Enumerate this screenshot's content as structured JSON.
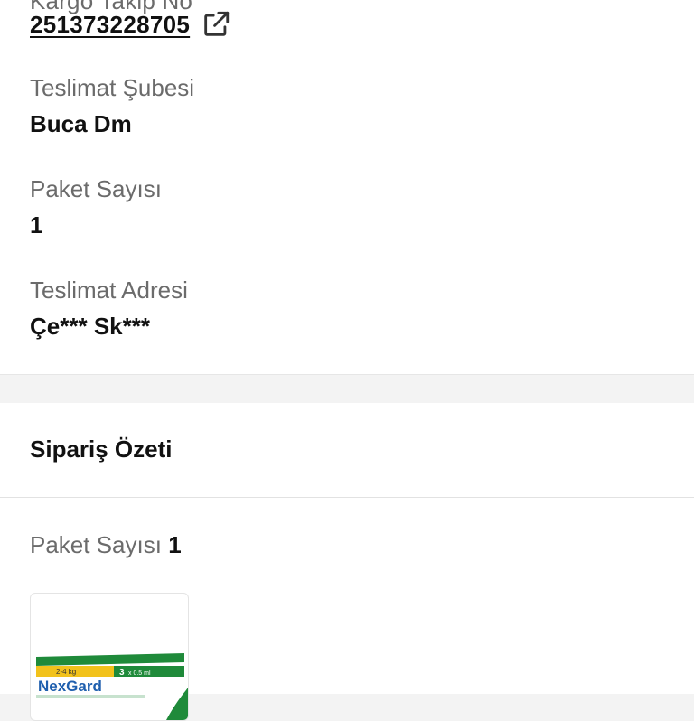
{
  "shipment": {
    "tracking_label_cut": "Kargo Takip No",
    "tracking_number": "251373228705",
    "branch_label": "Teslimat Şubesi",
    "branch_value": "Buca Dm",
    "package_count_label": "Paket Sayısı",
    "package_count_value": "1",
    "address_label": "Teslimat Adresi",
    "address_value": "Çe*** Sk***"
  },
  "summary": {
    "title": "Sipariş Özeti",
    "package_count_label": "Paket Sayısı",
    "package_count_value": "1",
    "product": {
      "brand": "NexGard",
      "pack_weight": "2-4 kg",
      "pack_qty": "3",
      "pack_unit": "x 0.5 ml"
    }
  },
  "colors": {
    "label": "#6b6b6b",
    "value": "#111111",
    "page_bg": "#f3f3f3",
    "product_green": "#1f8a3a",
    "product_yellow": "#f2c21b",
    "product_blue": "#1f5fae"
  },
  "icons": {
    "external_link": "external-link-icon"
  }
}
